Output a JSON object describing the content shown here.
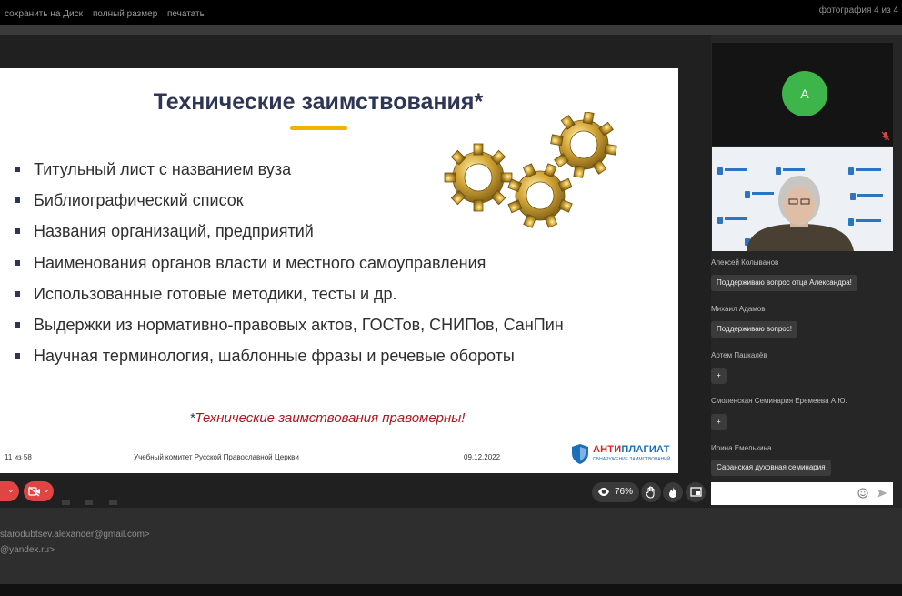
{
  "viewer": {
    "save_to_disk": "сохранить на Диск",
    "full_size": "полный размер",
    "print": "печатать",
    "counter": "фотография 4 из 4"
  },
  "slide": {
    "title": "Технические заимствования*",
    "bullets": [
      "Титульный лист с названием вуза",
      "Библиографический список",
      "Названия организаций, предприятий",
      "Наименования органов власти и местного самоуправления",
      "Использованные готовые методики, тесты и др.",
      "Выдержки из нормативно-правовых актов, ГОСТов, СНИПов, СанПин",
      "Научная терминология, шаблонные фразы и речевые обороты"
    ],
    "note_asterisk": "*",
    "note_text": "Технические заимствования правомерны!",
    "footer": {
      "page": "11  из  58",
      "organization": "Учебный комитет Русской Православной Церкви",
      "date": "09.12.2022",
      "brand_prefix": "АНТИ",
      "brand_rest": "ПЛАГИАТ",
      "brand_sub": "ОБНАРУЖЕНИЕ ЗАИМСТВОВАНИЙ"
    }
  },
  "controls": {
    "zoom": "76%"
  },
  "participants": {
    "avatar_letter": "А"
  },
  "chat": {
    "messages": [
      {
        "author": "Алексей Колыванов",
        "text": "Поддерживаю вопрос отца Александра!"
      },
      {
        "author": "Михаил Адамов",
        "text": "Поддерживаю вопрос!"
      },
      {
        "author": "Артем Пацкалёв",
        "text": "+"
      },
      {
        "author": "Смоленская Семинария Еремеева А.Ю.",
        "text": "+"
      },
      {
        "author": "Ирина Емелькина",
        "text": "Саранская духовная семинария"
      }
    ]
  },
  "emails": {
    "line1": "starodubtsev.alexander@gmail.com>",
    "line2": "@yandex.ru>"
  },
  "colors": {
    "accent_red": "#e04545",
    "avatar_green": "#3db54a",
    "title_navy": "#2f3655",
    "underline_gold": "#f0b400",
    "legal_red": "#b0171f"
  }
}
